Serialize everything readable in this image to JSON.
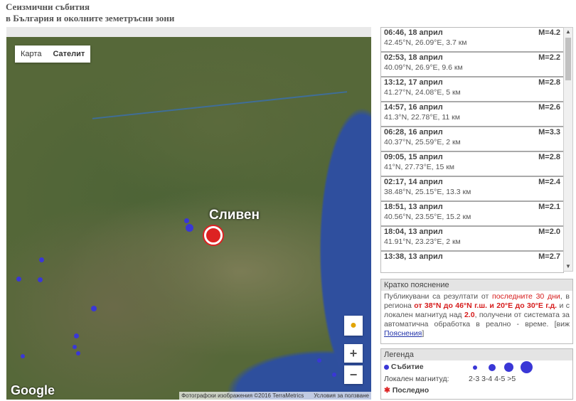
{
  "title": {
    "line1": "Сеизмични събития",
    "line2": "в България и околните земетръсни зони"
  },
  "map": {
    "type_buttons": [
      {
        "label": "Карта",
        "active": false
      },
      {
        "label": "Сателит",
        "active": true
      }
    ],
    "city_label": "Сливен",
    "zoom_in": "+",
    "zoom_out": "−",
    "logo": "Google",
    "attribution": {
      "imagery": "Фотографски изображения ©2016 TerraMetrics",
      "terms": "Условия за ползване"
    }
  },
  "events": [
    {
      "time": "06:46, 18 април",
      "mag": "M=4.2",
      "coords": "42.45°N, 26.09°E, 3.7 км"
    },
    {
      "time": "02:53, 18 април",
      "mag": "M=2.2",
      "coords": "40.09°N, 26.9°E, 9.6 км"
    },
    {
      "time": "13:12, 17 април",
      "mag": "M=2.8",
      "coords": "41.27°N, 24.08°E, 5 км"
    },
    {
      "time": "14:57, 16 април",
      "mag": "M=2.6",
      "coords": "41.3°N, 22.78°E, 11 км"
    },
    {
      "time": "06:28, 16 април",
      "mag": "M=3.3",
      "coords": "40.37°N, 25.59°E, 2 км"
    },
    {
      "time": "09:05, 15 април",
      "mag": "M=2.8",
      "coords": "41°N, 27.73°E, 15 км"
    },
    {
      "time": "02:17, 14 април",
      "mag": "M=2.4",
      "coords": "38.48°N, 25.15°E, 13.3 км"
    },
    {
      "time": "18:51, 13 април",
      "mag": "M=2.1",
      "coords": "40.56°N, 23.55°E, 15.2 км"
    },
    {
      "time": "18:04, 13 април",
      "mag": "M=2.0",
      "coords": "41.91°N, 23.23°E, 2 км"
    },
    {
      "time": "13:38, 13 април",
      "mag": "M=2.7",
      "coords": ""
    }
  ],
  "explanation": {
    "heading": "Кратко пояснение",
    "t1": "Публикувани са резултати от ",
    "t2": "последните 30 дни",
    "t3": ", в региона ",
    "t4": "от 38°N до 46°N г.ш. и 20°E до 30°E г.д.",
    "t5": " и с локален магнитуд над ",
    "t6": "2.0",
    "t7": ", получени от системата за автоматична обработка в реално - време. [виж ",
    "link": "Пояснения",
    "t8": "]"
  },
  "legend": {
    "heading": "Легенда",
    "event_label": "Събитие",
    "mag_label": "Локален магнитуд:",
    "ranges": "2-3 3-4 4-5 >5",
    "latest_label": "Последно",
    "colors": {
      "event": "#3a37d6",
      "latest": "#d22222"
    }
  }
}
